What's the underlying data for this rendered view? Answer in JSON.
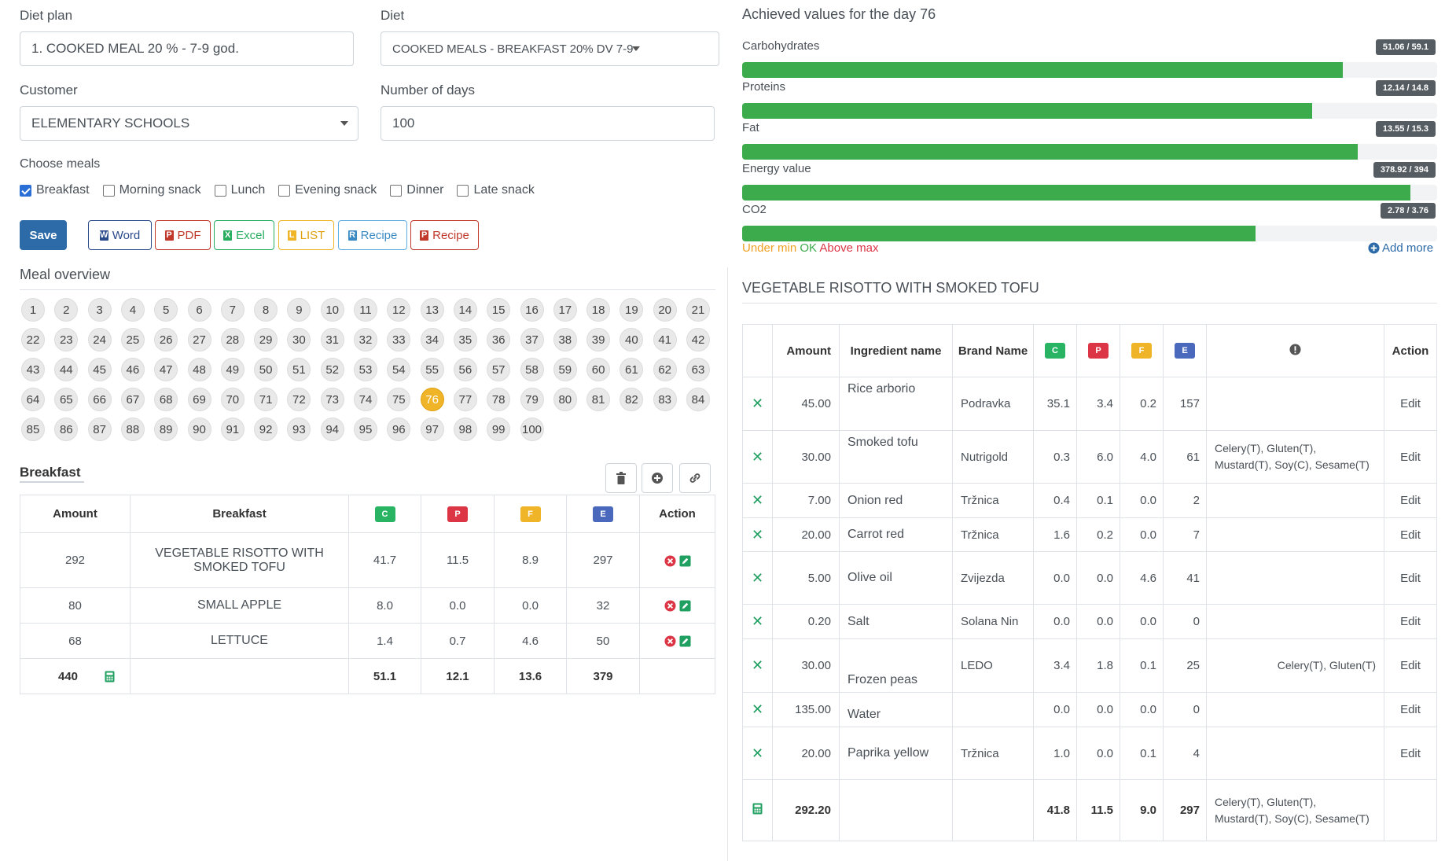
{
  "form": {
    "diet_plan_label": "Diet plan",
    "diet_plan_value": "1. COOKED MEAL 20 % - 7-9 god.",
    "diet_label": "Diet",
    "diet_value": "COOKED MEALS - BREAKFAST 20% DV 7-9",
    "customer_label": "Customer",
    "customer_value": "ELEMENTARY SCHOOLS",
    "days_label": "Number of days",
    "days_value": "100",
    "choose_meals_label": "Choose meals",
    "meals": [
      {
        "label": "Breakfast",
        "checked": true
      },
      {
        "label": "Morning snack",
        "checked": false
      },
      {
        "label": "Lunch",
        "checked": false
      },
      {
        "label": "Evening snack",
        "checked": false
      },
      {
        "label": "Dinner",
        "checked": false
      },
      {
        "label": "Late snack",
        "checked": false
      }
    ]
  },
  "toolbar": {
    "save": "Save",
    "word": "Word",
    "pdf": "PDF",
    "excel": "Excel",
    "list": "LIST",
    "recipe1": "Recipe",
    "recipe2": "Recipe"
  },
  "colors": {
    "primary": "#2c6aa8",
    "green": "#3cab4b",
    "badge_c": "#28b463",
    "badge_p": "#dc3545",
    "badge_f": "#f0b429",
    "badge_e": "#4a69bd",
    "active_day": "#f0b429"
  },
  "meal_overview": {
    "title": "Meal overview",
    "active_day": 76,
    "days_total": 100
  },
  "breakfast": {
    "title": "Breakfast",
    "headers": {
      "amount": "Amount",
      "name": "Breakfast",
      "c": "C",
      "p": "P",
      "f": "F",
      "e": "E",
      "action": "Action"
    },
    "rows": [
      {
        "amount": "292",
        "name": "VEGETABLE RISOTTO WITH SMOKED TOFU",
        "c": "41.7",
        "p": "11.5",
        "f": "8.9",
        "e": "297"
      },
      {
        "amount": "80",
        "name": "SMALL APPLE",
        "c": "8.0",
        "p": "0.0",
        "f": "0.0",
        "e": "32"
      },
      {
        "amount": "68",
        "name": "LETTUCE",
        "c": "1.4",
        "p": "0.7",
        "f": "4.6",
        "e": "50"
      }
    ],
    "total": {
      "amount": "440",
      "c": "51.1",
      "p": "12.1",
      "f": "13.6",
      "e": "379"
    }
  },
  "achieved": {
    "title": "Achieved values for the day 76",
    "bars": [
      {
        "label": "Carbohydrates",
        "value": "51.06 / 59.1",
        "fraction": 0.864
      },
      {
        "label": "Proteins",
        "value": "12.14 / 14.8",
        "fraction": 0.82
      },
      {
        "label": "Fat",
        "value": "13.55 / 15.3",
        "fraction": 0.886
      },
      {
        "label": "Energy value",
        "value": "378.92 / 394",
        "fraction": 0.962
      },
      {
        "label": "CO2",
        "value": "2.78 / 3.76",
        "fraction": 0.739
      }
    ],
    "legend_under": "Under min",
    "legend_ok": "OK",
    "legend_above": "Above max",
    "add_more": "Add more"
  },
  "recipe": {
    "title": "VEGETABLE RISOTTO WITH SMOKED TOFU",
    "headers": {
      "amount": "Amount",
      "ingredient": "Ingredient name",
      "brand": "Brand Name",
      "c": "C",
      "p": "P",
      "f": "F",
      "e": "E",
      "action": "Action"
    },
    "rows": [
      {
        "amount": "45.00",
        "name": "Rice arborio",
        "brand": "Podravka",
        "c": "35.1",
        "p": "3.4",
        "f": "0.2",
        "e": "157",
        "allergens": "",
        "action": "Edit"
      },
      {
        "amount": "30.00",
        "name": "Smoked tofu",
        "brand": "Nutrigold",
        "c": "0.3",
        "p": "6.0",
        "f": "4.0",
        "e": "61",
        "allergens": "Celery(T), Gluten(T), Mustard(T), Soy(C), Sesame(T)",
        "action": "Edit"
      },
      {
        "amount": "7.00",
        "name": "Onion red",
        "brand": "Tržnica",
        "c": "0.4",
        "p": "0.1",
        "f": "0.0",
        "e": "2",
        "allergens": "",
        "action": "Edit"
      },
      {
        "amount": "20.00",
        "name": "Carrot red",
        "brand": "Tržnica",
        "c": "1.6",
        "p": "0.2",
        "f": "0.0",
        "e": "7",
        "allergens": "",
        "action": "Edit"
      },
      {
        "amount": "5.00",
        "name": "Olive oil",
        "brand": "Zvijezda",
        "c": "0.0",
        "p": "0.0",
        "f": "4.6",
        "e": "41",
        "allergens": "",
        "action": "Edit"
      },
      {
        "amount": "0.20",
        "name": "Salt",
        "brand": "Solana Nin",
        "c": "0.0",
        "p": "0.0",
        "f": "0.0",
        "e": "0",
        "allergens": "",
        "action": "Edit"
      },
      {
        "amount": "30.00",
        "name": "Frozen peas",
        "brand": "LEDO",
        "c": "3.4",
        "p": "1.8",
        "f": "0.1",
        "e": "25",
        "allergens": "Celery(T), Gluten(T)",
        "action": "Edit"
      },
      {
        "amount": "135.00",
        "name": "Water",
        "brand": "",
        "c": "0.0",
        "p": "0.0",
        "f": "0.0",
        "e": "0",
        "allergens": "",
        "action": "Edit"
      },
      {
        "amount": "20.00",
        "name": "Paprika yellow",
        "brand": "Tržnica",
        "c": "1.0",
        "p": "0.0",
        "f": "0.1",
        "e": "4",
        "allergens": "",
        "action": "Edit"
      }
    ],
    "total": {
      "amount": "292.20",
      "c": "41.8",
      "p": "11.5",
      "f": "9.0",
      "e": "297",
      "allergens": "Celery(T), Gluten(T), Mustard(T), Soy(C), Sesame(T)"
    }
  }
}
